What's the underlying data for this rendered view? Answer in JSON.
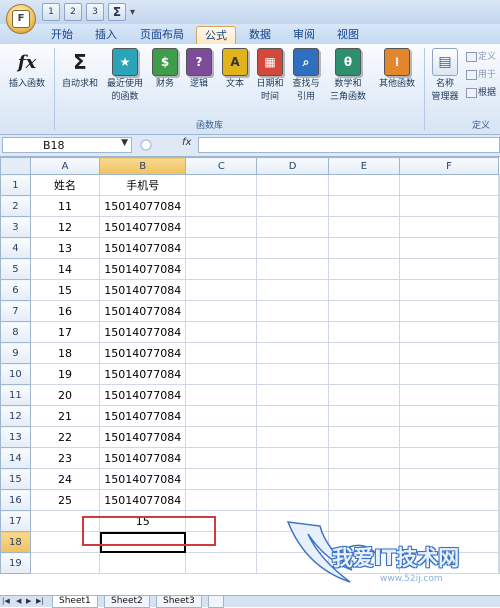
{
  "office_button": {
    "label": "F"
  },
  "qat": {
    "items": [
      "1",
      "2",
      "3"
    ],
    "sum_label": "Σ",
    "dropdown": "▾"
  },
  "tabs": [
    {
      "label": "开始"
    },
    {
      "label": "插入"
    },
    {
      "label": "页面布局"
    },
    {
      "label": "公式",
      "active": true
    },
    {
      "label": "数据"
    },
    {
      "label": "审阅"
    },
    {
      "label": "视图"
    }
  ],
  "ribbon": {
    "buttons": [
      {
        "label": "插入函数",
        "icon": "fx-icon",
        "symbol": "fx"
      },
      {
        "label": "自动求和",
        "icon": "sigma-icon",
        "symbol": "Σ"
      },
      {
        "label": "最近使用\n的函数",
        "icon": "recent-book-icon",
        "symbol": "★"
      },
      {
        "label": "财务",
        "icon": "finance-book-icon",
        "symbol": "$"
      },
      {
        "label": "逻辑",
        "icon": "logic-book-icon",
        "symbol": "?"
      },
      {
        "label": "文本",
        "icon": "text-book-icon",
        "symbol": "A"
      },
      {
        "label": "日期和\n时间",
        "icon": "datetime-book-icon",
        "symbol": "▦"
      },
      {
        "label": "查找与\n引用",
        "icon": "lookup-book-icon",
        "symbol": "⌕"
      },
      {
        "label": "数学和\n三角函数",
        "icon": "math-book-icon",
        "symbol": "θ"
      },
      {
        "label": "其他函数",
        "icon": "more-book-icon",
        "symbol": "⁞"
      },
      {
        "label": "名称\n管理器",
        "icon": "name-manager-icon",
        "symbol": "▤"
      }
    ],
    "group_label": "函数库",
    "define_group": {
      "items": [
        "定义",
        "用于",
        "根据"
      ],
      "group_label": "定义"
    },
    "colors": {
      "green": "#3e9c4a",
      "purple": "#7c4b9a",
      "yellow": "#e0b21c",
      "red": "#d2493b",
      "blue": "#2f6fbf",
      "teal": "#2e8f6e",
      "orange": "#e3872e",
      "cyan": "#2aa4b9"
    }
  },
  "formula_bar": {
    "name_box": "B18",
    "fx_label": "fx",
    "content": ""
  },
  "sheet": {
    "columns": [
      "A",
      "B",
      "C",
      "D",
      "E",
      "F"
    ],
    "rows": [
      {
        "n": "1",
        "a": "姓名",
        "b": "手机号"
      },
      {
        "n": "2",
        "a": "11",
        "b": "15014077084"
      },
      {
        "n": "3",
        "a": "12",
        "b": "15014077084"
      },
      {
        "n": "4",
        "a": "13",
        "b": "15014077084"
      },
      {
        "n": "5",
        "a": "14",
        "b": "15014077084"
      },
      {
        "n": "6",
        "a": "15",
        "b": "15014077084"
      },
      {
        "n": "7",
        "a": "16",
        "b": "15014077084"
      },
      {
        "n": "8",
        "a": "17",
        "b": "15014077084"
      },
      {
        "n": "9",
        "a": "18",
        "b": "15014077084"
      },
      {
        "n": "10",
        "a": "19",
        "b": "15014077084"
      },
      {
        "n": "11",
        "a": "20",
        "b": "15014077084"
      },
      {
        "n": "12",
        "a": "21",
        "b": "15014077084"
      },
      {
        "n": "13",
        "a": "22",
        "b": "15014077084"
      },
      {
        "n": "14",
        "a": "23",
        "b": "15014077084"
      },
      {
        "n": "15",
        "a": "24",
        "b": "15014077084"
      },
      {
        "n": "16",
        "a": "25",
        "b": "15014077084"
      },
      {
        "n": "17",
        "a": "",
        "b": "15"
      },
      {
        "n": "18",
        "a": "",
        "b": ""
      },
      {
        "n": "19",
        "a": "",
        "b": ""
      }
    ],
    "selected_cell": "B18",
    "highlight_color": "#d2393c"
  },
  "sheet_tabs": {
    "nav": [
      "|◀",
      "◀",
      "▶",
      "▶|"
    ],
    "tabs": [
      "Sheet1",
      "Sheet2",
      "Sheet3"
    ]
  },
  "watermark": {
    "text": "我爱IT技术网",
    "url": "www.52ij.com"
  }
}
